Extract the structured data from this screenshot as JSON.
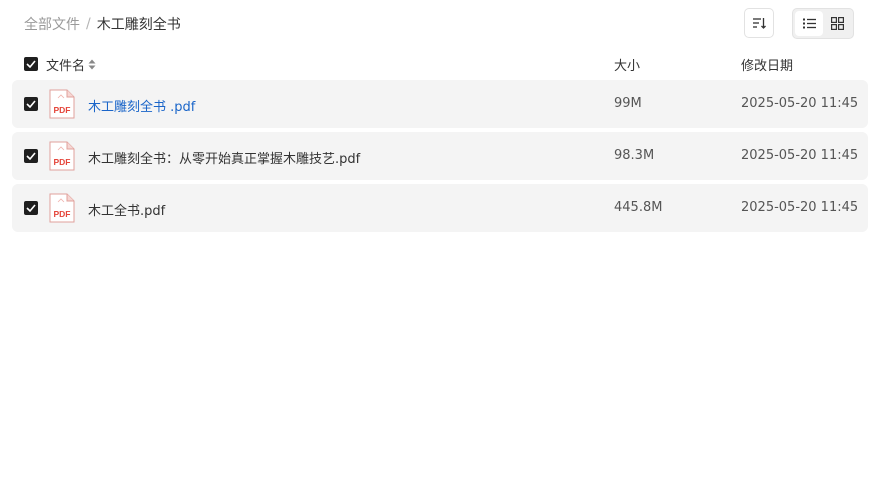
{
  "breadcrumb": {
    "root": "全部文件",
    "separator": "/",
    "current": "木工雕刻全书"
  },
  "toolbar": {
    "sort_icon": "sort-icon",
    "list_view_icon": "list-view-icon",
    "grid_view_icon": "grid-view-icon",
    "active_view": "list"
  },
  "columns": {
    "name": "文件名",
    "size": "大小",
    "modified": "修改日期"
  },
  "files": [
    {
      "name": "木工雕刻全书 .pdf",
      "size": "99M",
      "modified": "2025-05-20 11:45",
      "checked": true,
      "icon": "pdf-file-icon"
    },
    {
      "name": "木工雕刻全书：从零开始真正掌握木雕技艺.pdf",
      "size": "98.3M",
      "modified": "2025-05-20 11:45",
      "checked": true,
      "icon": "pdf-file-icon"
    },
    {
      "name": "木工全书.pdf",
      "size": "445.8M",
      "modified": "2025-05-20 11:45",
      "checked": true,
      "icon": "pdf-file-icon"
    }
  ],
  "colors": {
    "accent_link": "#1a65c9",
    "row_background": "#f4f4f4",
    "pdf_red": "#e5453a"
  }
}
